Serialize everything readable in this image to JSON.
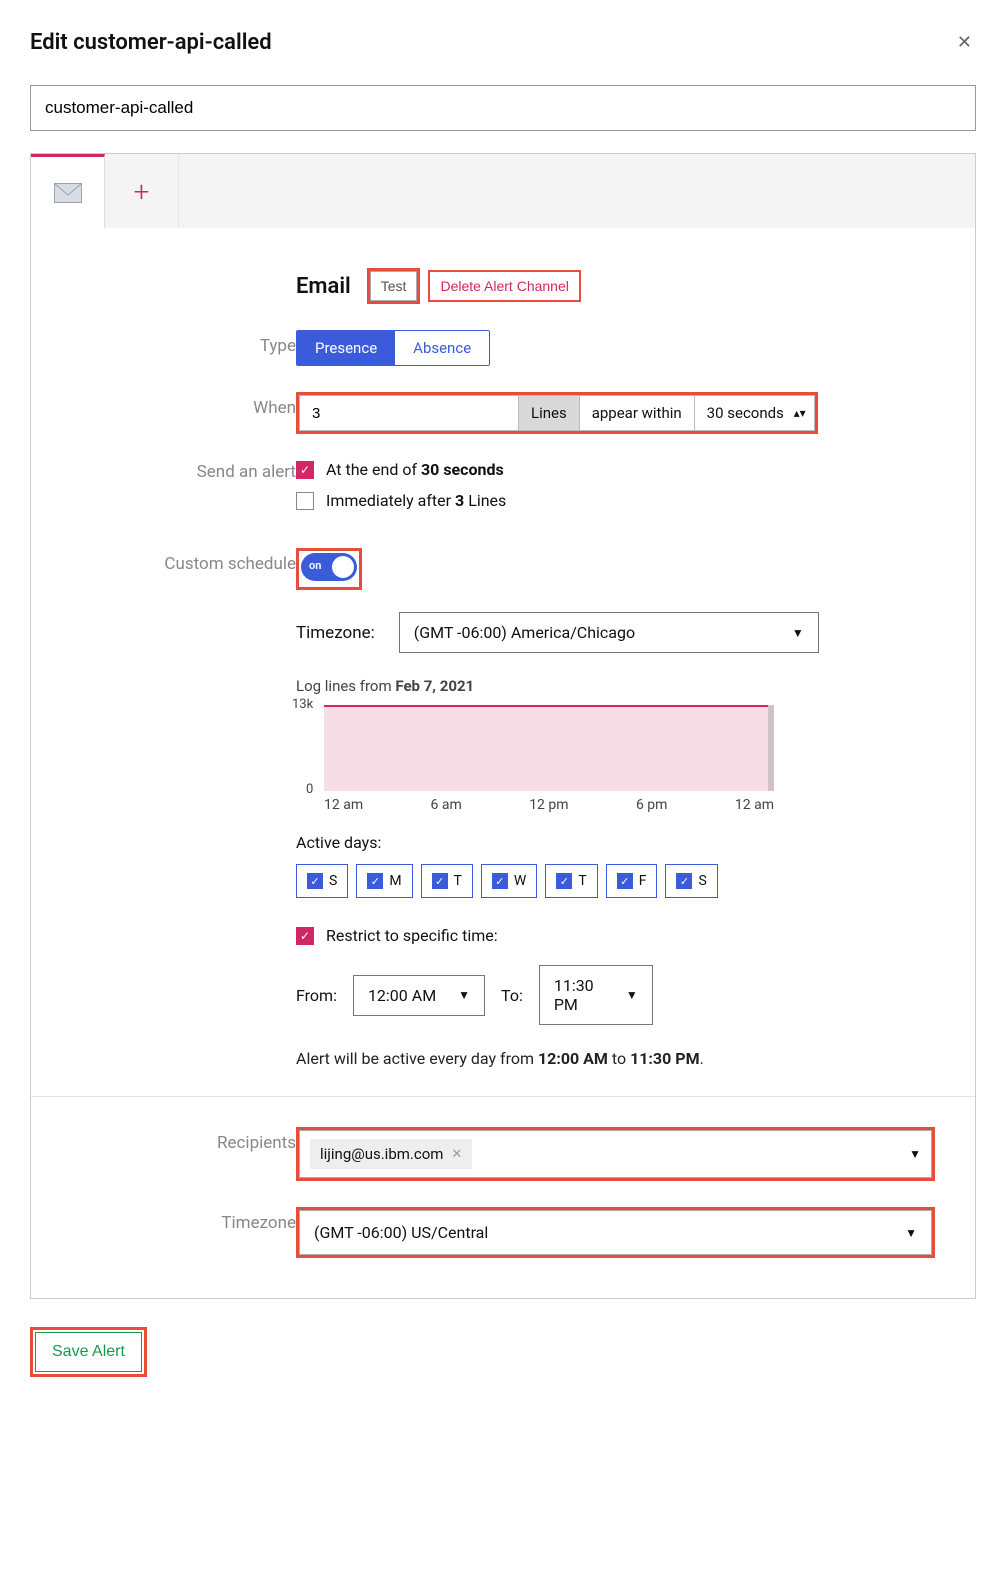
{
  "title": "Edit customer-api-called",
  "alert_name": "customer-api-called",
  "email": {
    "section_title": "Email",
    "test_label": "Test",
    "delete_label": "Delete Alert Channel"
  },
  "type": {
    "label": "Type",
    "presence": "Presence",
    "absence": "Absence",
    "selected": "Presence"
  },
  "when": {
    "label": "When",
    "value": "3",
    "unit_label": "Lines",
    "appear_label": "appear within",
    "window": "30 seconds"
  },
  "send_alert": {
    "label": "Send an alert",
    "end_prefix": "At the end of ",
    "end_bold": "30 seconds",
    "immediate_prefix": "Immediately after ",
    "immediate_bold": "3",
    "immediate_suffix": " Lines",
    "end_checked": true,
    "immediate_checked": false
  },
  "schedule": {
    "label": "Custom schedule",
    "toggle": "on",
    "timezone_label": "Timezone:",
    "timezone_value": "(GMT -06:00) America/Chicago",
    "log_lines_prefix": "Log lines from ",
    "log_lines_date": "Feb 7, 2021",
    "chart_ymax": "13k",
    "chart_ymin": "0",
    "x_ticks": [
      "12 am",
      "6 am",
      "12 pm",
      "6 pm",
      "12 am"
    ],
    "active_days_label": "Active days:",
    "days": [
      "S",
      "M",
      "T",
      "W",
      "T",
      "F",
      "S"
    ],
    "restrict_label": "Restrict to specific time:",
    "from_label": "From:",
    "from_value": "12:00 AM",
    "to_label": "To:",
    "to_value": "11:30 PM",
    "active_prefix": "Alert will be active every day from ",
    "active_from": "12:00 AM",
    "active_mid": " to ",
    "active_to": "11:30 PM",
    "active_suffix": "."
  },
  "recipients": {
    "label": "Recipients",
    "value": "lijing@us.ibm.com"
  },
  "footer_tz": {
    "label": "Timezone",
    "value": "(GMT -06:00) US/Central"
  },
  "save_label": "Save Alert",
  "chart_data": {
    "type": "area",
    "title": "Log lines from Feb 7, 2021",
    "xlabel": "",
    "ylabel": "",
    "ylim": [
      0,
      13000
    ],
    "x_ticks": [
      "12 am",
      "6 am",
      "12 pm",
      "6 pm",
      "12 am"
    ],
    "series": [
      {
        "name": "log lines",
        "values": [
          12800,
          12700,
          12600,
          12700,
          12500,
          12600,
          12700,
          12600,
          12700,
          12500,
          12700,
          12900,
          12700
        ]
      }
    ],
    "note": "Values approximate a nearly-flat line slightly below 13k across 24h"
  }
}
